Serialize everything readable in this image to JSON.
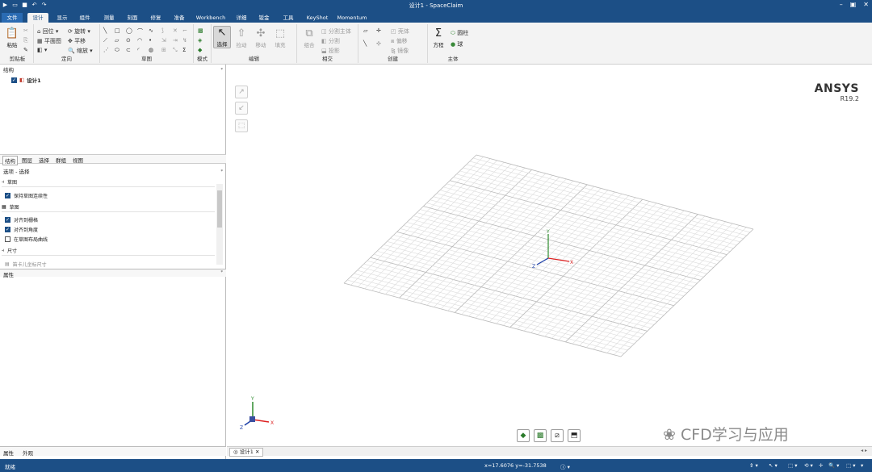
{
  "window": {
    "title": "设计1 - SpaceClaim",
    "controls": [
      "–",
      "▣",
      "✕"
    ]
  },
  "ribbon_tabs": [
    {
      "label": "文件"
    },
    {
      "label": "设计"
    },
    {
      "label": "显示"
    },
    {
      "label": "组件"
    },
    {
      "label": "测量"
    },
    {
      "label": "刻面"
    },
    {
      "label": "修复"
    },
    {
      "label": "准备"
    },
    {
      "label": "Workbench"
    },
    {
      "label": "详细"
    },
    {
      "label": "钣金"
    },
    {
      "label": "工具"
    },
    {
      "label": "KeyShot"
    },
    {
      "label": "Momentum"
    }
  ],
  "ribbon": {
    "clipboard": {
      "label": "剪贴板",
      "paste": "粘贴"
    },
    "orient": {
      "label": "定向",
      "home": "回位",
      "plan": "平面图",
      "rotate": "旋转",
      "pan": "平移",
      "zoom": "缩放"
    },
    "sketch": {
      "label": "草图"
    },
    "mode": {
      "label": "模式"
    },
    "edit": {
      "label": "编辑",
      "select": "选择",
      "pull": "拉动",
      "move": "移动",
      "fill": "填充"
    },
    "intersect": {
      "label": "相交",
      "combine": "组合",
      "split_body": "分割主体",
      "split": "分割",
      "project": "投影"
    },
    "create": {
      "label": "创建",
      "shell": "壳体",
      "offset": "偏移",
      "mirror": "镜像"
    },
    "body": {
      "label": "主体",
      "equation": "方程",
      "cylinder": "圆柱",
      "sphere": "球"
    }
  },
  "structure": {
    "header": "结构",
    "item": "设计1"
  },
  "left_tabs": [
    "结构",
    "图层",
    "选择",
    "群组",
    "视图"
  ],
  "options": {
    "header": "选项 - 选择",
    "sections": [
      {
        "title": "草图",
        "items": [
          {
            "label": "保持草图连续性",
            "checked": true
          }
        ]
      },
      {
        "title": "草图",
        "items": [
          {
            "label": "对齐到栅格",
            "checked": true
          },
          {
            "label": "对齐到角度",
            "checked": true
          },
          {
            "label": "在草图布局曲线",
            "checked": false
          }
        ]
      },
      {
        "title": "尺寸",
        "items": [
          {
            "label": "笛卡儿坐标尺寸",
            "checked": false
          }
        ]
      }
    ]
  },
  "properties": {
    "header": "属性"
  },
  "bottom_tabs": [
    "属性",
    "外观"
  ],
  "doc_tab": "设计1",
  "brand": {
    "name": "ANSYS",
    "version": "R19.2"
  },
  "watermark": "CFD学习与应用",
  "status": {
    "text": "就绪",
    "coords": "x=17.6076  y=-31.7538"
  },
  "axes": {
    "x": "X",
    "y": "Y",
    "z": "Z"
  }
}
